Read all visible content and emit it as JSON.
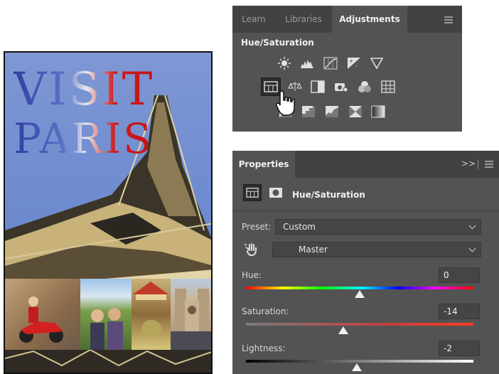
{
  "poster": {
    "title_line1": "VISIT",
    "title_line2": "PARIS"
  },
  "adjustments_panel": {
    "tabs": [
      {
        "label": "Learn",
        "active": false
      },
      {
        "label": "Libraries",
        "active": false
      },
      {
        "label": "Adjustments",
        "active": true
      }
    ],
    "heading": "Hue/Saturation",
    "icons_row1": [
      "brightness-contrast-icon",
      "levels-icon",
      "curves-icon",
      "exposure-icon",
      "vibrance-icon"
    ],
    "icons_row2": [
      "hue-saturation-icon",
      "color-balance-icon",
      "black-white-icon",
      "photo-filter-icon",
      "channel-mixer-icon",
      "color-lookup-icon"
    ],
    "icons_row3": [
      "invert-icon",
      "posterize-icon",
      "threshold-icon",
      "selective-color-icon",
      "gradient-map-icon"
    ],
    "selected_icon": "hue-saturation-icon"
  },
  "properties_panel": {
    "tab_label": "Properties",
    "collapse_glyph": ">>",
    "header_title": "Hue/Saturation",
    "preset_label": "Preset:",
    "preset_value": "Custom",
    "channel_value": "Master",
    "hue": {
      "label": "Hue:",
      "value": "0"
    },
    "saturation": {
      "label": "Saturation:",
      "value": "-14"
    },
    "lightness": {
      "label": "Lightness:",
      "value": "-2"
    }
  },
  "colors": {
    "panel_bg": "#535353",
    "tabbar_bg": "#424242",
    "field_bg": "#454545",
    "poster_sky": "#6f8cd0"
  }
}
